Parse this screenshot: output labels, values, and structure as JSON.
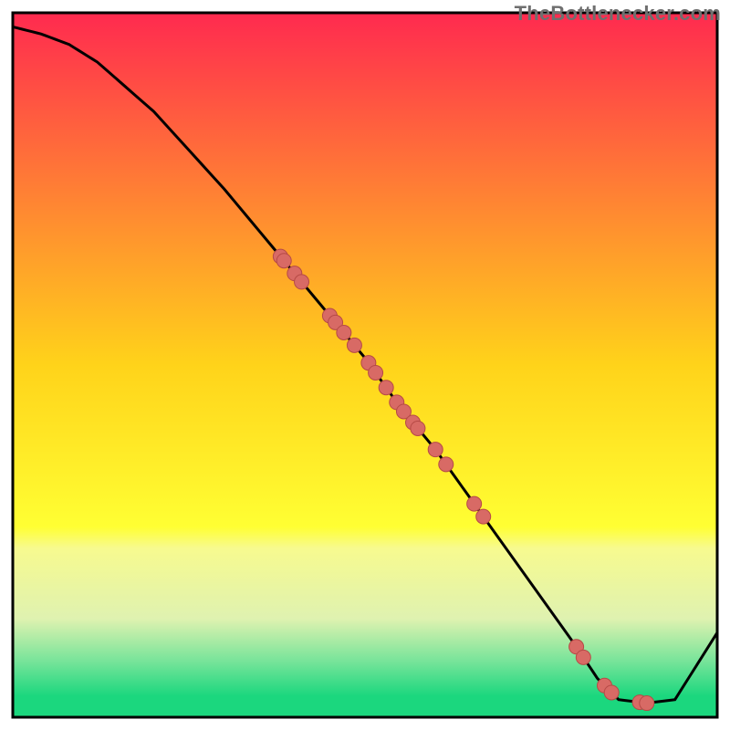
{
  "watermark": "TheBottlenecker.com",
  "colors": {
    "frame": "#000000",
    "curve": "#000000",
    "point_fill": "#d86a65",
    "point_stroke": "#b64a46"
  },
  "chart_data": {
    "type": "line",
    "title": "",
    "xlabel": "",
    "ylabel": "",
    "xlim": [
      0,
      100
    ],
    "ylim": [
      0,
      100
    ],
    "grid": false,
    "legend": false,
    "background": {
      "type": "vertical-gradient",
      "stops": [
        {
          "y": 0,
          "color": "#ff2a4f"
        },
        {
          "y": 50,
          "color": "#ffd31a"
        },
        {
          "y": 73,
          "color": "#ffff33"
        },
        {
          "y": 76,
          "color": "#f7fa8f"
        },
        {
          "y": 86,
          "color": "#dff2b0"
        },
        {
          "y": 92,
          "color": "#78e49a"
        },
        {
          "y": 97,
          "color": "#1bd77e"
        },
        {
          "y": 100,
          "color": "#1bd77e"
        }
      ]
    },
    "series": [
      {
        "name": "bottleneck-curve",
        "x": [
          0,
          4,
          8,
          12,
          20,
          30,
          40,
          50,
          55,
          60,
          65,
          70,
          75,
          80,
          83,
          86,
          90,
          94,
          100
        ],
        "y": [
          98,
          97,
          95.5,
          93,
          86,
          75,
          63,
          51,
          44,
          38,
          31,
          24,
          17,
          10,
          5.5,
          2.5,
          2,
          2.5,
          12
        ]
      }
    ],
    "scatter": {
      "name": "measured-points",
      "on_curve_x": [
        38,
        38.5,
        40,
        41,
        45,
        45.8,
        47,
        48.5,
        50.5,
        51.5,
        53,
        54.5,
        55.5,
        56.8,
        57.5,
        60,
        61.5,
        65.5,
        66.8,
        80,
        81,
        84,
        85,
        89,
        90
      ],
      "radius": 8
    }
  }
}
